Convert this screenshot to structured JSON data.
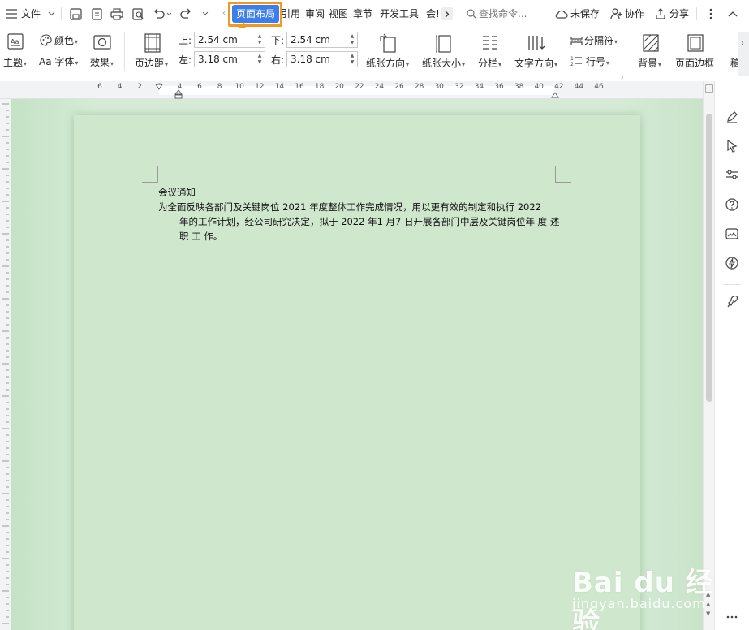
{
  "menubar": {
    "menu_label": "文件",
    "tabs": [
      {
        "label": "页面布局",
        "active": true
      },
      {
        "label": "引用"
      },
      {
        "label": "审阅"
      },
      {
        "label": "视图"
      },
      {
        "label": "章节"
      },
      {
        "label": "开发工具"
      },
      {
        "label": "会!"
      }
    ],
    "search_placeholder": "查找命令...",
    "unsaved_label": "未保存",
    "collab_label": "协作",
    "share_label": "分享"
  },
  "ribbon": {
    "theme_label": "主题",
    "color_label": "颜色",
    "font_label": "Aa 字体",
    "effect_label": "效果",
    "margin_label": "页边距",
    "top_label": "上:",
    "top_value": "2.54 cm",
    "bottom_label": "下:",
    "bottom_value": "2.54 cm",
    "left_label": "左:",
    "left_value": "3.18 cm",
    "right_label": "右:",
    "right_value": "3.18 cm",
    "orientation_label": "纸张方向",
    "size_label": "纸张大小",
    "columns_label": "分栏",
    "text_direction_label": "文字方向",
    "separator_label": "分隔符",
    "line_number_label": "行号",
    "background_label": "背景",
    "page_border_label": "页面边框",
    "overflow_label": "稿"
  },
  "ruler": {
    "ticks": [
      "6",
      "4",
      "2",
      "2",
      "4",
      "6",
      "8",
      "10",
      "12",
      "14",
      "16",
      "18",
      "20",
      "22",
      "24",
      "26",
      "28",
      "30",
      "32",
      "34",
      "36",
      "38",
      "40",
      "42",
      "44",
      "46"
    ]
  },
  "document": {
    "title": "会议通知",
    "line1": "为全面反映各部门及关键岗位 2021 年度整体工作完成情况，用以更有效的制定和执行 2022",
    "line2": "年的工作计划，经公司研究决定，拟于 2022 年1 月7 日开展各部门中层及关键岗位年 度 述",
    "line3": "职 工 作。"
  },
  "watermark": {
    "logo": "Bai du 经验",
    "url": "jingyan.baidu.com"
  },
  "colors": {
    "accent": "#3d7ee8",
    "highlight": "#f39a1e",
    "page_bg": "#cfe8cd"
  }
}
